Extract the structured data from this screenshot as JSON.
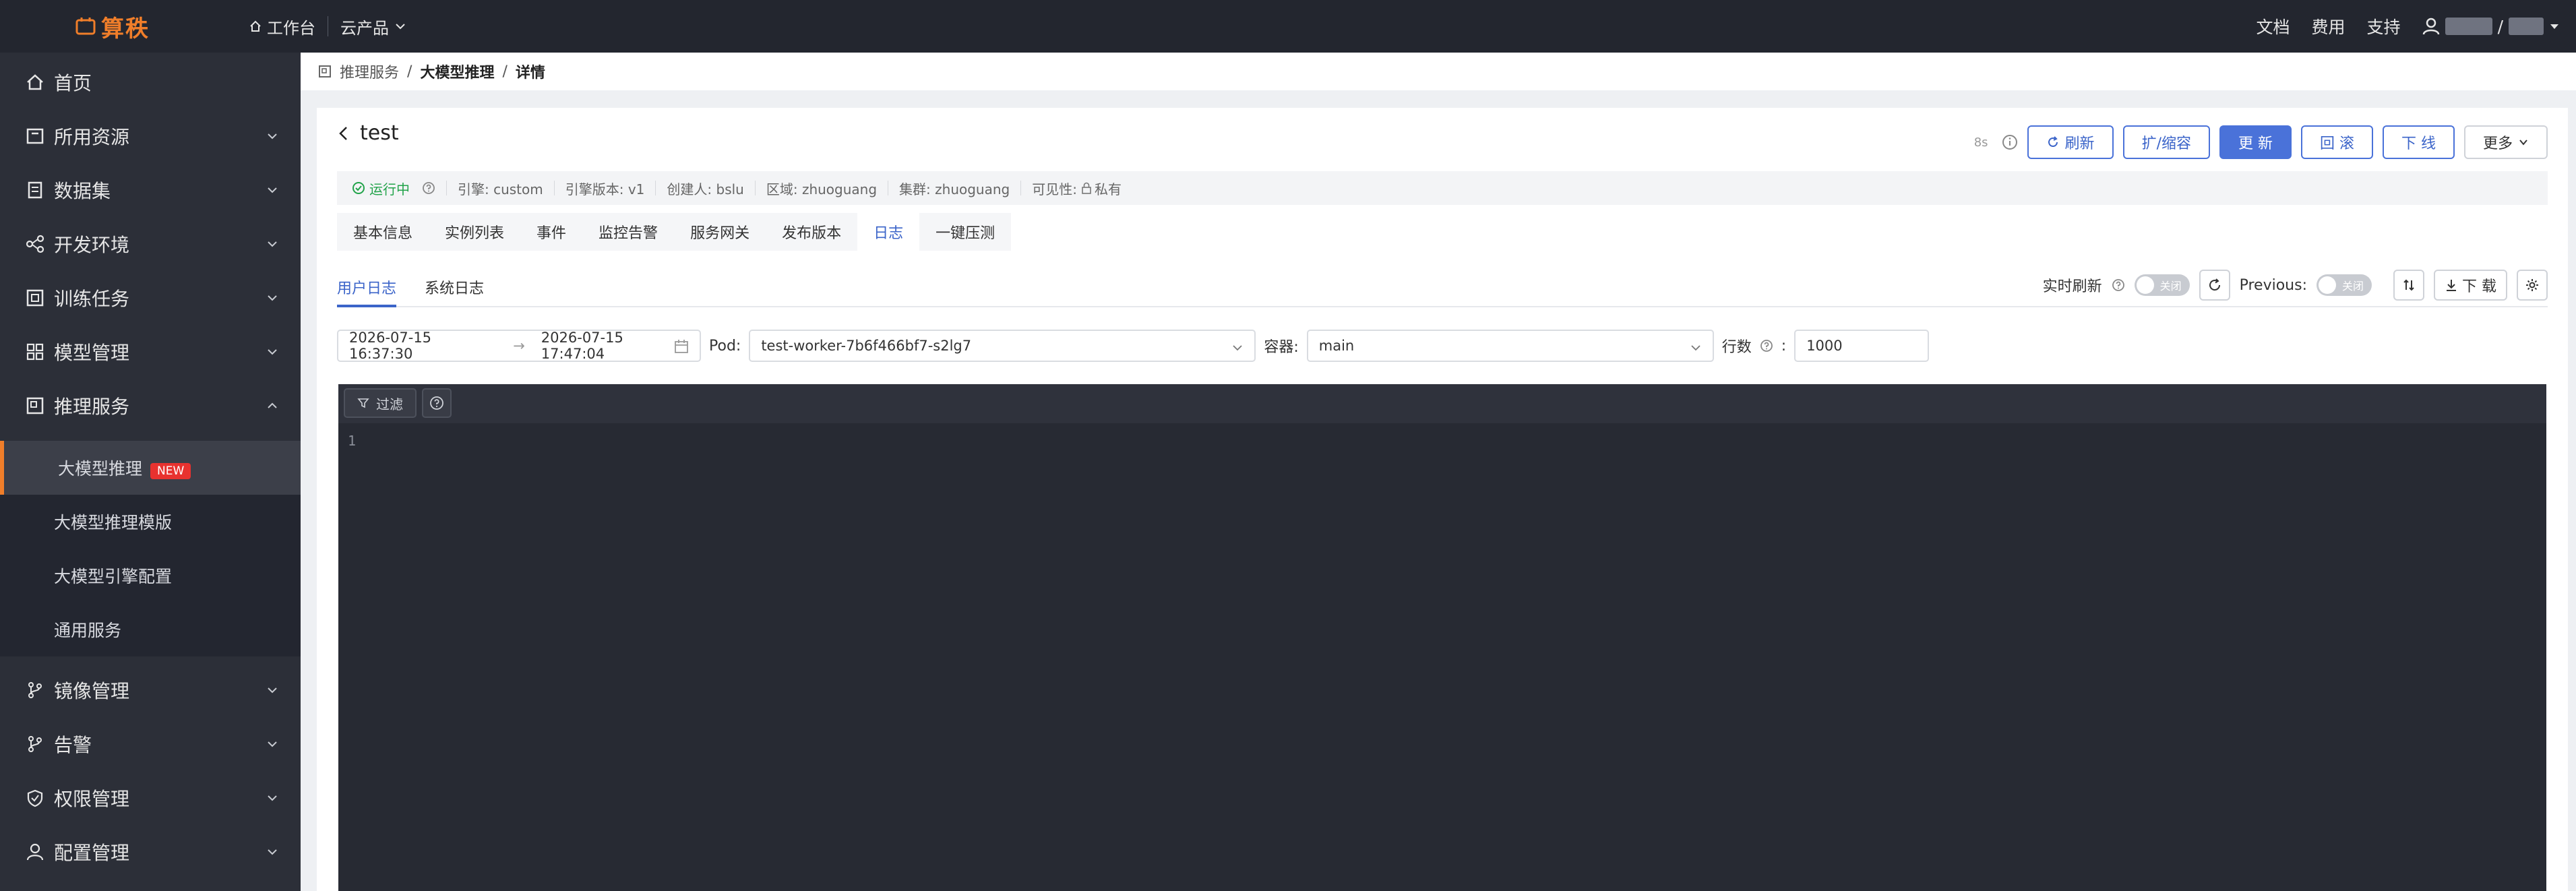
{
  "topbar": {
    "logo_text": "算秩",
    "workbench": "工作台",
    "cloud_products": "云产品",
    "docs": "文档",
    "billing": "费用",
    "support": "支持",
    "user_sep": "/"
  },
  "sidebar": {
    "items": [
      {
        "label": "首页",
        "icon": "home-icon"
      },
      {
        "label": "所用资源",
        "icon": "resource-icon"
      },
      {
        "label": "数据集",
        "icon": "dataset-icon"
      },
      {
        "label": "开发环境",
        "icon": "dev-env-icon"
      },
      {
        "label": "训练任务",
        "icon": "training-icon"
      },
      {
        "label": "模型管理",
        "icon": "model-icon"
      },
      {
        "label": "推理服务",
        "icon": "inference-icon"
      }
    ],
    "sub_items": [
      {
        "label": "大模型推理",
        "badge": "NEW"
      },
      {
        "label": "大模型推理模版"
      },
      {
        "label": "大模型引擎配置"
      },
      {
        "label": "通用服务"
      }
    ],
    "bottom_items": [
      {
        "label": "镜像管理",
        "icon": "image-mgmt-icon"
      },
      {
        "label": "告警",
        "icon": "alert-icon"
      },
      {
        "label": "权限管理",
        "icon": "permission-icon"
      },
      {
        "label": "配置管理",
        "icon": "config-icon"
      }
    ]
  },
  "breadcrumb": {
    "root": "推理服务",
    "sep": "/",
    "parent": "大模型推理",
    "current": "详情"
  },
  "detail": {
    "title": "test",
    "hint": "8s",
    "actions": {
      "refresh": "刷新",
      "scale": "扩/缩容",
      "update": "更 新",
      "rollback": "回 滚",
      "offline": "下 线",
      "more": "更多"
    },
    "info": {
      "status": "运行中",
      "engine": "引擎: custom",
      "engine_version": "引擎版本: v1",
      "creator": "创建人: bslu",
      "region": "区域: zhuoguang",
      "cluster": "集群: zhuoguang",
      "visibility_label": "可见性:",
      "visibility": "私有"
    },
    "tabs": [
      "基本信息",
      "实例列表",
      "事件",
      "监控告警",
      "服务网关",
      "发布版本",
      "日志",
      "一键压测"
    ],
    "active_tab": 6,
    "log_tabs": {
      "user": "用户日志",
      "system": "系统日志"
    },
    "log_tools": {
      "realtime_label": "实时刷新",
      "realtime_state": "关闭",
      "previous_label": "Previous:",
      "previous_state": "关闭",
      "download": "下 载"
    },
    "filters": {
      "start_time": "2026-07-15 16:37:30",
      "end_time": "2026-07-15 17:47:04",
      "pod_label": "Pod:",
      "pod_value": "test-worker-7b6f466bf7-s2lg7",
      "container_label": "容器:",
      "container_value": "main",
      "lines_label": "行数",
      "lines_value": "1000"
    },
    "log_viewer": {
      "filter_btn": "过滤",
      "first_line_no": "1"
    }
  },
  "colors": {
    "topbar_bg": "#23262f",
    "sidebar_bg": "#2c2f38",
    "accent": "#f07e2a",
    "primary": "#4a72d9",
    "success": "#22a34a",
    "badge": "#e8322f",
    "log_bg": "#272a33"
  }
}
